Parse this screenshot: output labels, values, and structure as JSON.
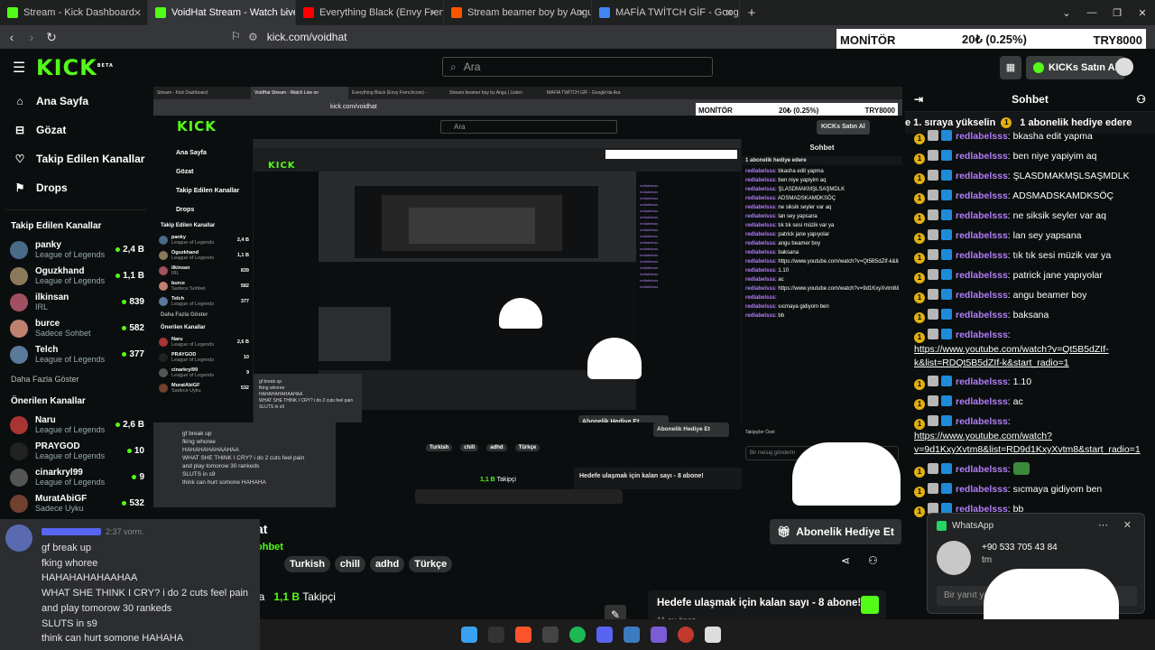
{
  "tabs": [
    {
      "label": "Stream - Kick Dashboard",
      "color": "#53fc18",
      "active": false
    },
    {
      "label": "VoidHat Stream - Watch Live on",
      "color": "#53fc18",
      "active": true
    },
    {
      "label": "Everything Black (Envy Frenchcore) -",
      "color": "#ff0000",
      "active": false
    },
    {
      "label": "Stream beamer boy by Angu | Listen",
      "color": "#ff5500",
      "active": false
    },
    {
      "label": "MAFİA TWİTCH GİF - Google'da Ara",
      "color": "#4285f4",
      "active": false
    }
  ],
  "url": "kick.com/voidhat",
  "ticker": {
    "label": "MONİTÖR",
    "change": "20₺ (0.25%)",
    "pair": "TRY8000"
  },
  "header": {
    "logo": "KICK",
    "beta": "BETA",
    "search_placeholder": "Ara",
    "buy_button": "KICKs Satın Al"
  },
  "nav": [
    {
      "icon": "home-icon",
      "label": "Ana Sayfa"
    },
    {
      "icon": "compass-icon",
      "label": "Gözat"
    },
    {
      "icon": "heart-icon",
      "label": "Takip Edilen Kanallar"
    },
    {
      "icon": "gift-icon",
      "label": "Drops"
    }
  ],
  "followed_title": "Takip Edilen Kanallar",
  "followed": [
    {
      "name": "panky",
      "category": "League of Legends",
      "viewers": "2,4 B",
      "color": "#4a6a8a"
    },
    {
      "name": "Oguzkhand",
      "category": "League of Legends",
      "viewers": "1,1 B",
      "color": "#8a7a5a"
    },
    {
      "name": "ilkinsan",
      "category": "IRL",
      "viewers": "839",
      "color": "#a05060"
    },
    {
      "name": "burce",
      "category": "Sadece Sohbet",
      "viewers": "582",
      "color": "#c08070"
    },
    {
      "name": "Telch",
      "category": "League of Legends",
      "viewers": "377",
      "color": "#5a7a9a"
    }
  ],
  "show_more": "Daha Fazla Göster",
  "recommended_title": "Önerilen Kanallar",
  "recommended": [
    {
      "name": "Naru",
      "category": "League of Legends",
      "viewers": "2,6 B",
      "color": "#aa3333"
    },
    {
      "name": "PRAYGOD",
      "category": "League of Legends",
      "viewers": "10",
      "color": "#222222"
    },
    {
      "name": "cinarkryl99",
      "category": "League of Legends",
      "viewers": "9",
      "color": "#555555"
    },
    {
      "name": "MuratAbiGF",
      "category": "Sadece Uyku",
      "viewers": "532",
      "color": "#704030"
    }
  ],
  "chat": {
    "title": "Sohbet",
    "pinned": "e 1. sıraya yükselin",
    "pinned2": "1 abonelik hediye edere",
    "user": "redlabelsss",
    "messages": [
      {
        "text": "bkasha edit yapma",
        "type": "text"
      },
      {
        "text": "ben niye yapiyim aq",
        "type": "text"
      },
      {
        "text": "ŞLASDMAKMŞLSAŞMDLK",
        "type": "text"
      },
      {
        "text": "ADSMADSKAMDKSÖÇ",
        "type": "text"
      },
      {
        "text": "ne siksik seyler var aq",
        "type": "text"
      },
      {
        "text": "lan sey yapsana",
        "type": "text"
      },
      {
        "text": "tık tık sesi müzik var ya",
        "type": "text"
      },
      {
        "text": "patrick jane yapıyolar",
        "type": "text"
      },
      {
        "text": "angu beamer boy",
        "type": "text"
      },
      {
        "text": "baksana",
        "type": "text"
      },
      {
        "text": "https://www.youtube.com/watch?v=Qt5B5dZIf-k&list=RDQt5B5dZIf-k&start_radio=1",
        "type": "link"
      },
      {
        "text": "1.10",
        "type": "text"
      },
      {
        "text": "ac",
        "type": "text"
      },
      {
        "text": "https://www.youtube.com/watch?v=9d1KxyXvtm8&list=RD9d1KxyXvtm8&start_radio=1",
        "type": "link"
      },
      {
        "text": "",
        "type": "emote"
      },
      {
        "text": "sıcmaya gidiyom ben",
        "type": "text"
      },
      {
        "text": "bb",
        "type": "text"
      }
    ]
  },
  "whatsapp": {
    "app": "WhatsApp",
    "phone": "+90 533 705 43 84",
    "text": "tm",
    "reply_placeholder": "Bir yanıt yaz"
  },
  "discord": {
    "time": "2:37 vorm.",
    "lines": [
      "gf break up",
      "fking whoree",
      "HAHAHAHAHAAHAA",
      "WHAT SHE THINK I CRY?  i do 2 cuts feel pain",
      "and play tomorow 30 rankeds",
      "SLUTS in s9",
      "think can hurt somone HAHAHA"
    ]
  },
  "stream": {
    "title_fragment": "at",
    "category_fragment": "ohbet",
    "tags": [
      "Turkish",
      "chill",
      "adhd",
      "Türkçe"
    ],
    "gift_button": "Abonelik Hediye Et",
    "followers_prefix": "da",
    "followers_count": "1,1 B",
    "followers_label": "Takipçi",
    "goal": "Hedefe ulaşmak için kalan sayı - 8 abone!",
    "goal_time": "11 ay önce"
  },
  "nested": {
    "chat_placeholder": "Bir mesaj gönderin",
    "followers_only": "Takipçiler Özel"
  }
}
